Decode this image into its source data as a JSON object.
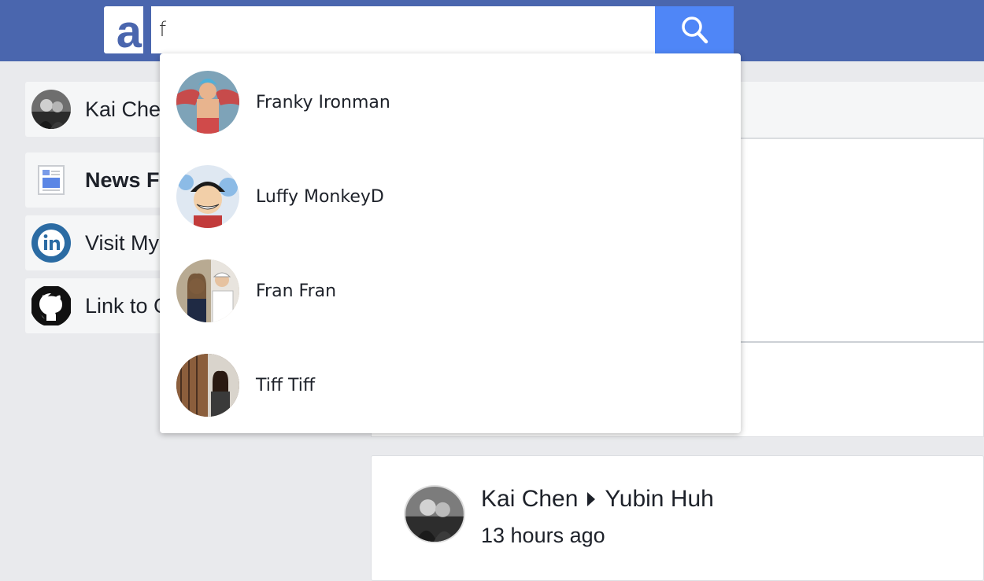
{
  "header": {
    "logo_letter": "a",
    "search_value": "f",
    "search_icon": "search-icon",
    "brand_color": "#4a66ae",
    "search_button_color": "#4f86f7"
  },
  "sidebar": {
    "items": [
      {
        "label": "Kai Chen",
        "icon": "user-avatar"
      },
      {
        "label": "News Feed",
        "icon": "newspaper-icon"
      },
      {
        "label": "Visit My LinkedIn",
        "icon": "linkedin-icon"
      },
      {
        "label": "Link to GitHub",
        "icon": "github-icon"
      }
    ]
  },
  "search_results": [
    {
      "name": "Franky Ironman"
    },
    {
      "name": "Luffy MonkeyD"
    },
    {
      "name": "Fran Fran"
    },
    {
      "name": "Tiff Tiff"
    }
  ],
  "post": {
    "author": "Kai Chen",
    "recipient": "Yubin Huh",
    "time": "13 hours ago"
  }
}
